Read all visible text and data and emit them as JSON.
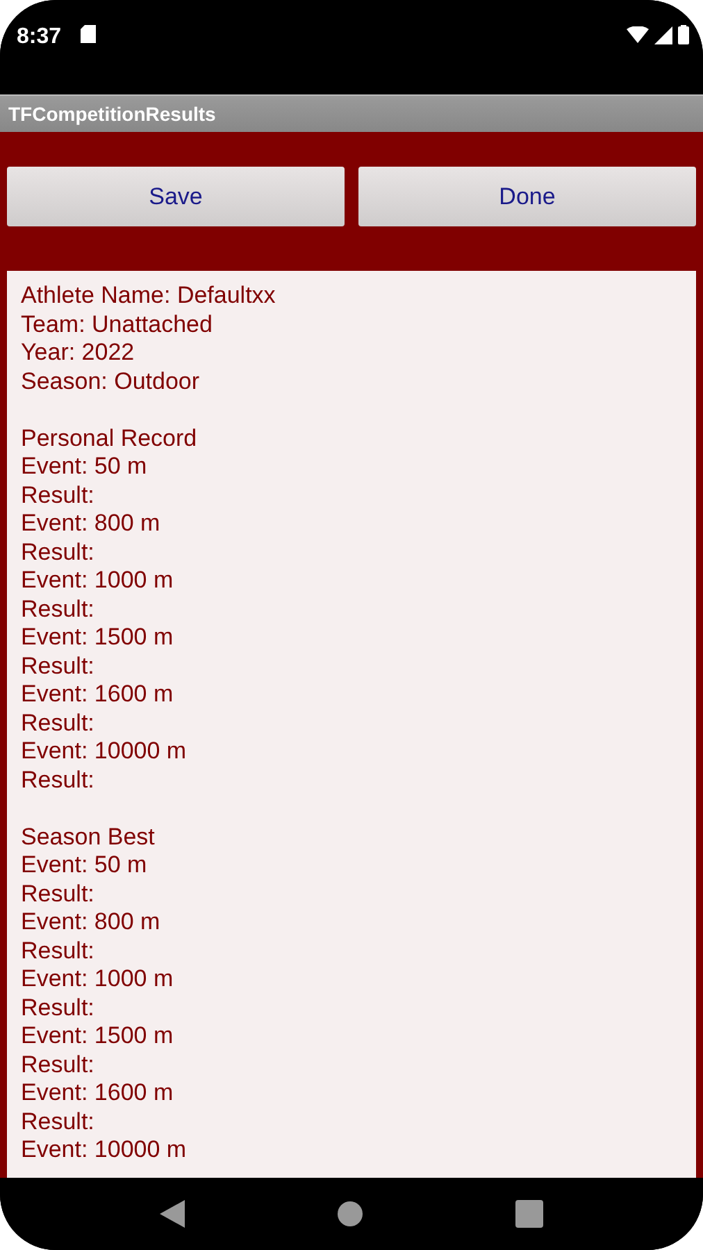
{
  "status_bar": {
    "time": "8:37"
  },
  "app_bar": {
    "title": "TFCompetitionResults"
  },
  "buttons": [
    {
      "label": "Save"
    },
    {
      "label": "Done"
    }
  ],
  "profile": [
    "Athlete Name: Defaultxx",
    "Team: Unattached",
    "Year: 2022",
    "Season: Outdoor"
  ],
  "sections": [
    {
      "title": "Personal Record",
      "lines": [
        "Event: 50 m",
        "Result:",
        "Event: 800 m",
        "Result:",
        "Event: 1000 m",
        "Result:",
        "Event: 1500 m",
        "Result:",
        "Event: 1600 m",
        "Result:",
        "Event: 10000 m",
        "Result:"
      ]
    },
    {
      "title": "Season Best",
      "lines": [
        "Event: 50 m",
        "Result:",
        "Event: 800 m",
        "Result:",
        "Event: 1000 m",
        "Result:",
        "Event: 1500 m",
        "Result:",
        "Event: 1600 m",
        "Result:",
        "Event: 10000 m"
      ]
    }
  ]
}
